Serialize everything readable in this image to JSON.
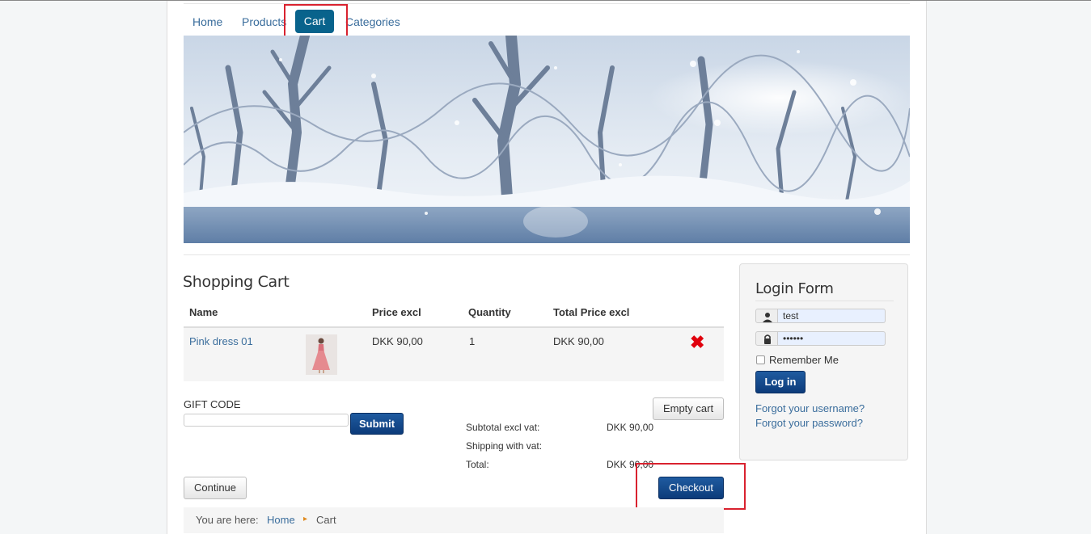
{
  "nav": {
    "items": [
      {
        "label": "Home"
      },
      {
        "label": "Products"
      },
      {
        "label": "Cart"
      },
      {
        "label": "Categories"
      }
    ]
  },
  "cart": {
    "title": "Shopping Cart",
    "columns": [
      "Name",
      "Price excl",
      "Quantity",
      "Total Price excl"
    ],
    "rows": [
      {
        "name": "Pink dress 01",
        "price": "DKK 90,00",
        "quantity": "1",
        "total": "DKK 90,00"
      }
    ],
    "gift_label": "GIFT CODE",
    "submit_label": "Submit",
    "empty_label": "Empty cart",
    "summary": {
      "subtotal_label": "Subtotal excl vat:",
      "subtotal_value": "DKK 90,00",
      "shipping_label": "Shipping with vat:",
      "total_label": "Total:",
      "total_value": "DKK 90,00"
    },
    "continue_label": "Continue",
    "checkout_label": "Checkout"
  },
  "breadcrumb": {
    "prefix": "You are here:",
    "home": "Home",
    "current": "Cart"
  },
  "login": {
    "title": "Login Form",
    "username": "test",
    "password": "••••••",
    "remember_label": "Remember Me",
    "login_label": "Log in",
    "forgot_username": "Forgot your username?",
    "forgot_password": "Forgot your password?"
  },
  "colors": {
    "accent": "#08638c",
    "button_blue": "#0c3b7a",
    "link": "#3a6d9c",
    "highlight": "#d9222f",
    "remove": "#e0000d"
  }
}
